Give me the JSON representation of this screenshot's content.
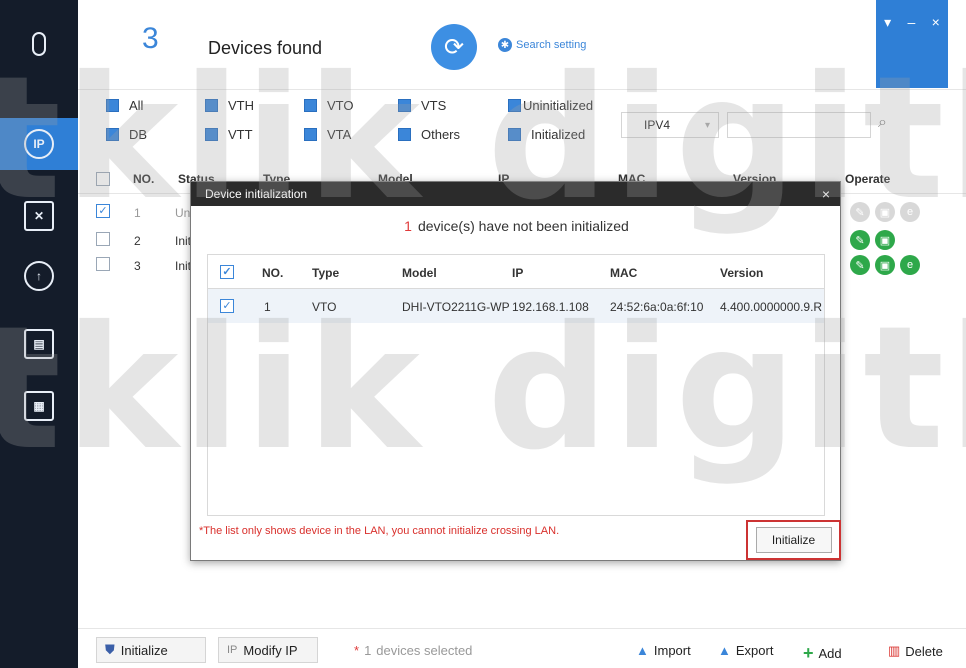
{
  "header": {
    "device_count": "3",
    "devices_found_label": "Devices found",
    "search_setting_label": "Search setting"
  },
  "window_controls": {
    "menu": "▾",
    "minimize": "–",
    "close": "×"
  },
  "filters": {
    "row1": [
      "All",
      "VTH",
      "VTO",
      "VTS",
      "Uninitialized"
    ],
    "row2": [
      "DB",
      "VTT",
      "VTA",
      "Others",
      "Initialized"
    ],
    "ip_version": "IPV4",
    "search_value": ""
  },
  "table": {
    "headers": {
      "no": "NO.",
      "status": "Status",
      "type": "Type",
      "model": "Model",
      "ip": "IP",
      "mac": "MAC",
      "version": "Version",
      "operate": "Operate"
    },
    "rows": [
      {
        "no": "1",
        "status": "Un"
      },
      {
        "no": "2",
        "status": "Init"
      },
      {
        "no": "3",
        "status": "Init"
      }
    ]
  },
  "dialog": {
    "title": "Device initialization",
    "close": "×",
    "uninit_count": "1",
    "message": "device(s) have not been initialized",
    "headers": {
      "no": "NO.",
      "type": "Type",
      "model": "Model",
      "ip": "IP",
      "mac": "MAC",
      "version": "Version"
    },
    "rows": [
      {
        "no": "1",
        "type": "VTO",
        "model": "DHI-VTO2211G-WP",
        "ip": "192.168.1.108",
        "mac": "24:52:6a:0a:6f:10",
        "version": "4.400.0000000.9.R"
      }
    ],
    "note": "*The list only shows device in the LAN, you cannot initialize crossing LAN.",
    "initialize_button": "Initialize"
  },
  "toolbar": {
    "initialize": "Initialize",
    "modify_ip": "Modify IP",
    "selected_count": "1",
    "selected_label": "devices selected",
    "import": "Import",
    "export": "Export",
    "add": "Add",
    "delete": "Delete"
  },
  "colors": {
    "accent": "#3b86d9",
    "sidebar": "#141c2a",
    "active": "#2f7fd6",
    "warning": "#d9302c"
  }
}
